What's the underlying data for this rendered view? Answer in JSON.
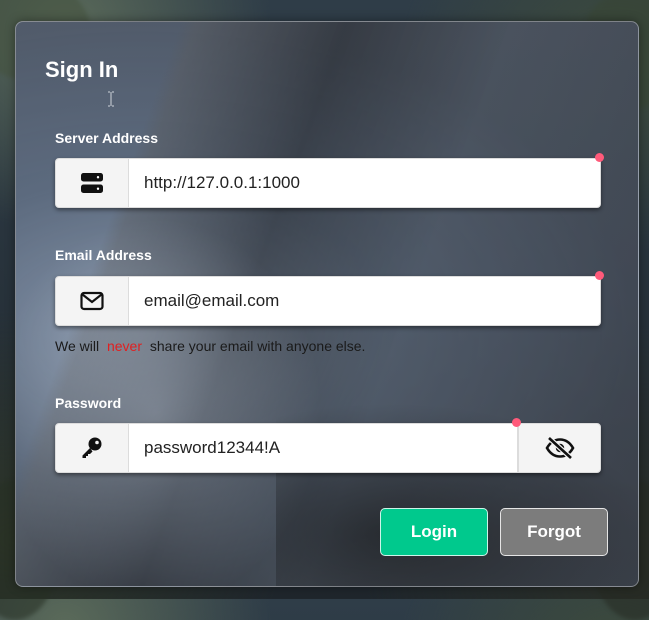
{
  "form": {
    "title": "Sign In",
    "server": {
      "label": "Server Address",
      "value": "http://127.0.0.1:1000",
      "icon": "server-icon"
    },
    "email": {
      "label": "Email Address",
      "value": "email@email.com",
      "icon": "envelope-icon"
    },
    "help": {
      "prefix": "We will",
      "emphasis": "never",
      "suffix": "share your email with anyone else."
    },
    "password": {
      "label": "Password",
      "value": "password12344!A",
      "icon": "key-icon",
      "toggle_icon": "eye-slash-icon"
    },
    "buttons": {
      "login": "Login",
      "forgot": "Forgot"
    }
  },
  "colors": {
    "login": "#00c98d",
    "forgot": "#7c7c7c",
    "required_dot": "#ff5a7a",
    "never_text": "#e02020"
  }
}
